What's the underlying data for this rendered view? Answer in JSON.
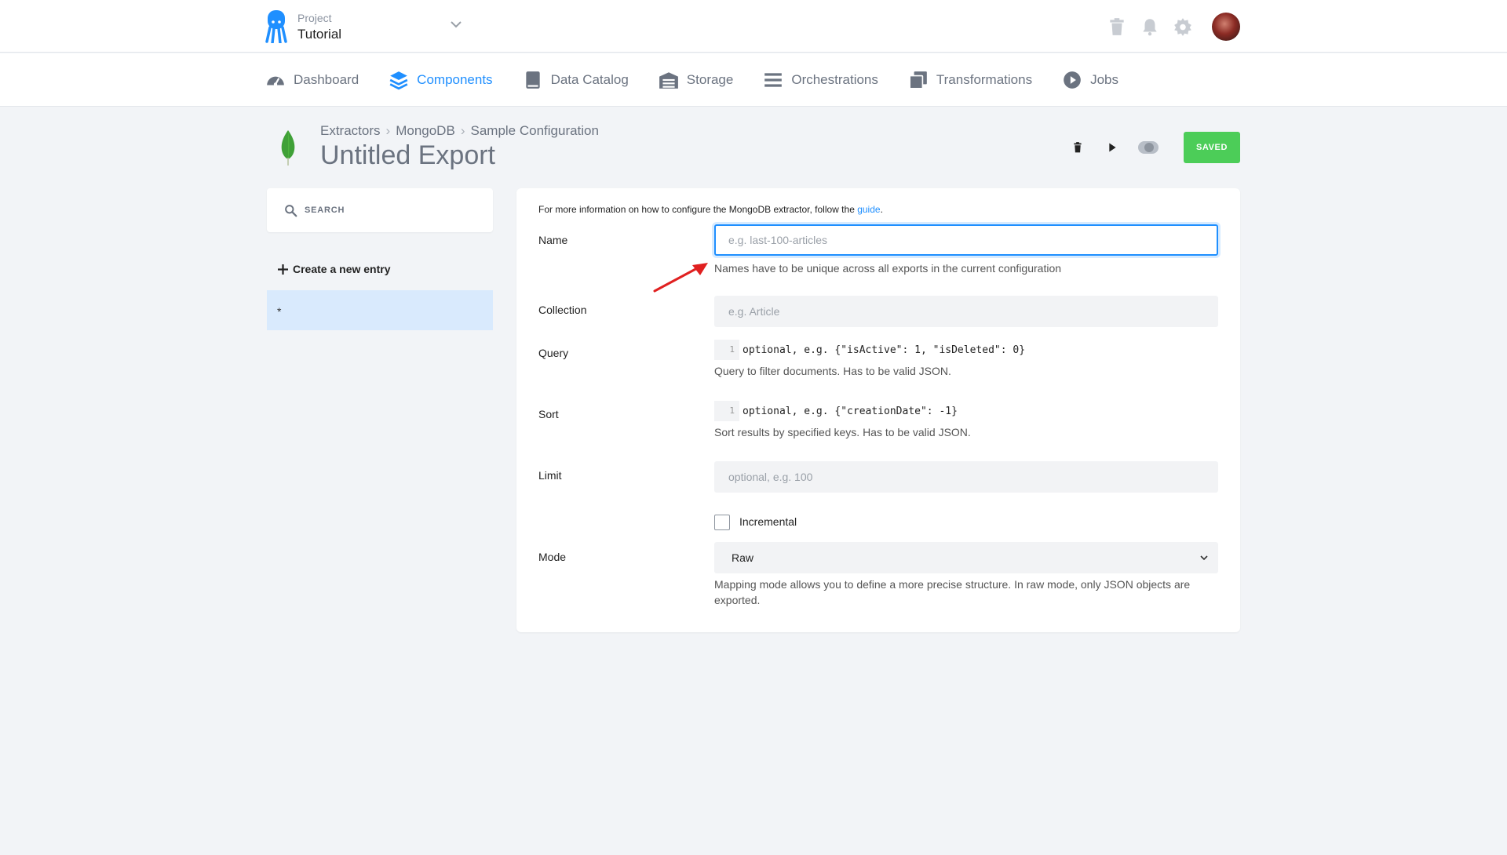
{
  "project": {
    "label": "Project",
    "name": "Tutorial"
  },
  "nav": [
    {
      "label": "Dashboard",
      "icon": "dashboard-icon"
    },
    {
      "label": "Components",
      "icon": "layers-icon",
      "active": true
    },
    {
      "label": "Data Catalog",
      "icon": "book-icon"
    },
    {
      "label": "Storage",
      "icon": "warehouse-icon"
    },
    {
      "label": "Orchestrations",
      "icon": "bars-icon"
    },
    {
      "label": "Transformations",
      "icon": "copy-icon"
    },
    {
      "label": "Jobs",
      "icon": "play-circle-icon"
    }
  ],
  "breadcrumb": [
    "Extractors",
    "MongoDB",
    "Sample Configuration"
  ],
  "page_title": "Untitled Export",
  "actions": {
    "saved_label": "SAVED"
  },
  "sidebar": {
    "search_placeholder": "SEARCH",
    "create_label": "Create a new entry",
    "entries": [
      "*"
    ]
  },
  "form": {
    "info_prefix": "For more information on how to configure the MongoDB extractor, follow the ",
    "info_link": "guide",
    "info_suffix": ".",
    "name": {
      "label": "Name",
      "placeholder": "e.g. last-100-articles",
      "help": "Names have to be unique across all exports in the current configuration"
    },
    "collection": {
      "label": "Collection",
      "placeholder": "e.g. Article"
    },
    "query": {
      "label": "Query",
      "line": "1",
      "code": "optional, e.g. {\"isActive\": 1, \"isDeleted\": 0}",
      "help": "Query to filter documents. Has to be valid JSON."
    },
    "sort": {
      "label": "Sort",
      "line": "1",
      "code": "optional, e.g. {\"creationDate\": -1}",
      "help": "Sort results by specified keys. Has to be valid JSON."
    },
    "limit": {
      "label": "Limit",
      "placeholder": "optional, e.g. 100"
    },
    "incremental": {
      "label": "Incremental",
      "checked": false
    },
    "mode": {
      "label": "Mode",
      "value": "Raw",
      "help_line1": "Mapping mode allows you to define a more precise structure. In raw mode, only JSON objects are",
      "help_line2": "exported."
    }
  },
  "colors": {
    "accent": "#1f8fff",
    "saved": "#4ccd58",
    "selected_entry": "#d9eafd",
    "annotation": "#e02020"
  }
}
